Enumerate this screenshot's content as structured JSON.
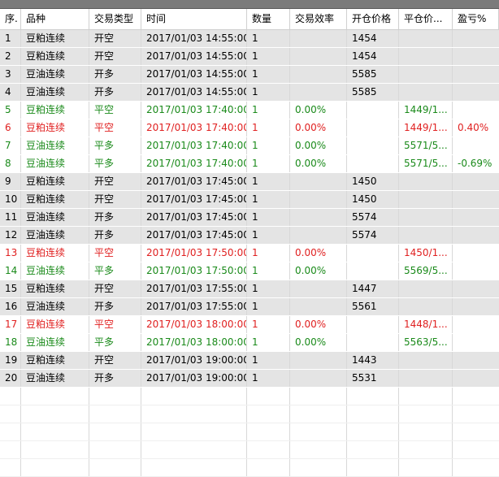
{
  "columns": [
    "序.",
    "品种",
    "交易类型",
    "时间",
    "数量",
    "交易效率",
    "开仓价格",
    "平仓价...",
    "盈亏%"
  ],
  "colors": {
    "green": "#1a8a1a",
    "red": "#e02020",
    "gray_row": "#e4e4e4"
  },
  "rows": [
    {
      "idx": "1",
      "variety": "豆粕连续",
      "type": "开空",
      "time": "2017/01/03 14:55:00",
      "qty": "1",
      "eff": "",
      "open": "1454",
      "close": "",
      "pl": "",
      "style": "gray"
    },
    {
      "idx": "2",
      "variety": "豆粕连续",
      "type": "开空",
      "time": "2017/01/03 14:55:00",
      "qty": "1",
      "eff": "",
      "open": "1454",
      "close": "",
      "pl": "",
      "style": "gray"
    },
    {
      "idx": "3",
      "variety": "豆油连续",
      "type": "开多",
      "time": "2017/01/03 14:55:00",
      "qty": "1",
      "eff": "",
      "open": "5585",
      "close": "",
      "pl": "",
      "style": "gray"
    },
    {
      "idx": "4",
      "variety": "豆油连续",
      "type": "开多",
      "time": "2017/01/03 14:55:00",
      "qty": "1",
      "eff": "",
      "open": "5585",
      "close": "",
      "pl": "",
      "style": "gray"
    },
    {
      "idx": "5",
      "variety": "豆粕连续",
      "type": "平空",
      "time": "2017/01/03 17:40:00",
      "qty": "1",
      "eff": "0.00%",
      "open": "",
      "close": "1449/1...",
      "pl": "",
      "style": "green"
    },
    {
      "idx": "6",
      "variety": "豆粕连续",
      "type": "平空",
      "time": "2017/01/03 17:40:00",
      "qty": "1",
      "eff": "0.00%",
      "open": "",
      "close": "1449/1...",
      "pl": "0.40%",
      "style": "red"
    },
    {
      "idx": "7",
      "variety": "豆油连续",
      "type": "平多",
      "time": "2017/01/03 17:40:00",
      "qty": "1",
      "eff": "0.00%",
      "open": "",
      "close": "5571/5...",
      "pl": "",
      "style": "green"
    },
    {
      "idx": "8",
      "variety": "豆油连续",
      "type": "平多",
      "time": "2017/01/03 17:40:00",
      "qty": "1",
      "eff": "0.00%",
      "open": "",
      "close": "5571/5...",
      "pl": "-0.69%",
      "style": "green"
    },
    {
      "idx": "9",
      "variety": "豆粕连续",
      "type": "开空",
      "time": "2017/01/03 17:45:00",
      "qty": "1",
      "eff": "",
      "open": "1450",
      "close": "",
      "pl": "",
      "style": "gray"
    },
    {
      "idx": "10",
      "variety": "豆粕连续",
      "type": "开空",
      "time": "2017/01/03 17:45:00",
      "qty": "1",
      "eff": "",
      "open": "1450",
      "close": "",
      "pl": "",
      "style": "gray"
    },
    {
      "idx": "11",
      "variety": "豆油连续",
      "type": "开多",
      "time": "2017/01/03 17:45:00",
      "qty": "1",
      "eff": "",
      "open": "5574",
      "close": "",
      "pl": "",
      "style": "gray"
    },
    {
      "idx": "12",
      "variety": "豆油连续",
      "type": "开多",
      "time": "2017/01/03 17:45:00",
      "qty": "1",
      "eff": "",
      "open": "5574",
      "close": "",
      "pl": "",
      "style": "gray"
    },
    {
      "idx": "13",
      "variety": "豆粕连续",
      "type": "平空",
      "time": "2017/01/03 17:50:00",
      "qty": "1",
      "eff": "0.00%",
      "open": "",
      "close": "1450/1...",
      "pl": "",
      "style": "red"
    },
    {
      "idx": "14",
      "variety": "豆油连续",
      "type": "平多",
      "time": "2017/01/03 17:50:00",
      "qty": "1",
      "eff": "0.00%",
      "open": "",
      "close": "5569/5...",
      "pl": "",
      "style": "green"
    },
    {
      "idx": "15",
      "variety": "豆粕连续",
      "type": "开空",
      "time": "2017/01/03 17:55:00",
      "qty": "1",
      "eff": "",
      "open": "1447",
      "close": "",
      "pl": "",
      "style": "gray"
    },
    {
      "idx": "16",
      "variety": "豆油连续",
      "type": "开多",
      "time": "2017/01/03 17:55:00",
      "qty": "1",
      "eff": "",
      "open": "5561",
      "close": "",
      "pl": "",
      "style": "gray"
    },
    {
      "idx": "17",
      "variety": "豆粕连续",
      "type": "平空",
      "time": "2017/01/03 18:00:00",
      "qty": "1",
      "eff": "0.00%",
      "open": "",
      "close": "1448/1...",
      "pl": "",
      "style": "red"
    },
    {
      "idx": "18",
      "variety": "豆油连续",
      "type": "平多",
      "time": "2017/01/03 18:00:00",
      "qty": "1",
      "eff": "0.00%",
      "open": "",
      "close": "5563/5...",
      "pl": "",
      "style": "green"
    },
    {
      "idx": "19",
      "variety": "豆粕连续",
      "type": "开空",
      "time": "2017/01/03 19:00:00",
      "qty": "1",
      "eff": "",
      "open": "1443",
      "close": "",
      "pl": "",
      "style": "gray"
    },
    {
      "idx": "20",
      "variety": "豆油连续",
      "type": "开多",
      "time": "2017/01/03 19:00:00",
      "qty": "1",
      "eff": "",
      "open": "5531",
      "close": "",
      "pl": "",
      "style": "gray"
    }
  ]
}
